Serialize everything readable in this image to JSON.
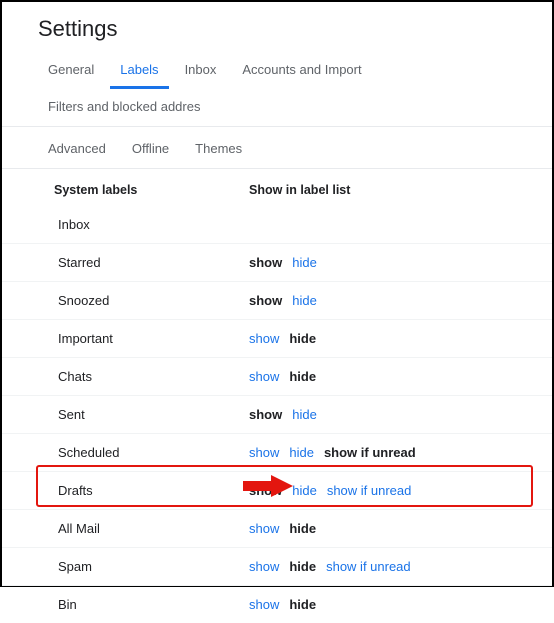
{
  "title": "Settings",
  "tabs_row1": [
    {
      "label": "General",
      "active": false
    },
    {
      "label": "Labels",
      "active": true
    },
    {
      "label": "Inbox",
      "active": false
    },
    {
      "label": "Accounts and Import",
      "active": false
    },
    {
      "label": "Filters and blocked addres",
      "active": false
    }
  ],
  "tabs_row2": [
    {
      "label": "Advanced",
      "active": false
    },
    {
      "label": "Offline",
      "active": false
    },
    {
      "label": "Themes",
      "active": false
    }
  ],
  "headers": {
    "system_labels": "System labels",
    "show_in_list": "Show in label list"
  },
  "action_text": {
    "show": "show",
    "hide": "hide",
    "show_if_unread": "show if unread"
  },
  "rows": [
    {
      "name": "Inbox",
      "show_selected": null,
      "unread": null,
      "unread_selected": null
    },
    {
      "name": "Starred",
      "show_selected": true,
      "unread": null,
      "unread_selected": null
    },
    {
      "name": "Snoozed",
      "show_selected": true,
      "unread": null,
      "unread_selected": null
    },
    {
      "name": "Important",
      "show_selected": false,
      "unread": null,
      "unread_selected": null
    },
    {
      "name": "Chats",
      "show_selected": false,
      "unread": null,
      "unread_selected": null
    },
    {
      "name": "Sent",
      "show_selected": true,
      "unread": null,
      "unread_selected": null
    },
    {
      "name": "Scheduled",
      "show_selected": null,
      "unread": true,
      "unread_selected": true
    },
    {
      "name": "Drafts",
      "show_selected": true,
      "unread": true,
      "unread_selected": false
    },
    {
      "name": "All Mail",
      "show_selected": false,
      "unread": null,
      "unread_selected": null
    },
    {
      "name": "Spam",
      "show_selected": false,
      "unread": true,
      "unread_selected": false
    },
    {
      "name": "Bin",
      "show_selected": false,
      "unread": null,
      "unread_selected": null
    }
  ]
}
